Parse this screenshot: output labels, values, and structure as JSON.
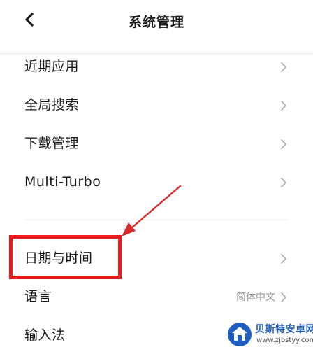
{
  "header": {
    "title": "系统管理",
    "back_icon": "chevron-left-icon"
  },
  "settings": {
    "items": [
      {
        "label": "近期应用",
        "value": ""
      },
      {
        "label": "全局搜索",
        "value": ""
      },
      {
        "label": "下载管理",
        "value": ""
      },
      {
        "label": "Multi-Turbo",
        "value": ""
      },
      {
        "label": "日期与时间",
        "value": ""
      },
      {
        "label": "语言",
        "value": "简体中文"
      },
      {
        "label": "输入法",
        "value": ""
      }
    ]
  },
  "annotation": {
    "highlight_color": "#e51d1d",
    "arrow_color": "#d62a2a"
  },
  "watermark": {
    "brand": "贝斯特安卓网",
    "url": "www.zjbstyy.com"
  }
}
